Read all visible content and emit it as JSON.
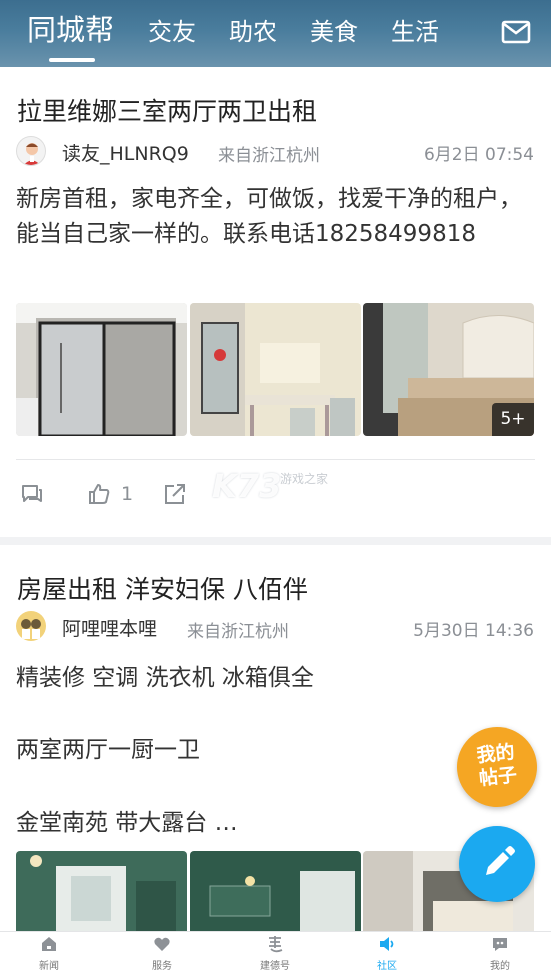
{
  "top_nav": {
    "tabs": [
      {
        "label": "同城帮",
        "active": true
      },
      {
        "label": "交友"
      },
      {
        "label": "助农"
      },
      {
        "label": "美食"
      },
      {
        "label": "生活"
      }
    ],
    "mail_icon": "mail-icon"
  },
  "posts": [
    {
      "title": "拉里维娜三室两厅两卫出租",
      "author": "读友_HLNRQ9",
      "origin": "来自浙江杭州",
      "time": "6月2日 07:54",
      "body": "新房首租，家电齐全，可做饭，找爱干净的租户，能当自己家一样的。联系电话18258499818",
      "more_images": "5+",
      "like_count": "1"
    },
    {
      "title": "房屋出租 洋安妇保 八佰伴",
      "author": "阿哩哩本哩",
      "origin": "来自浙江杭州",
      "time": "5月30日 14:36",
      "body_lines": [
        "精装修 空调 洗衣机 冰箱俱全",
        "两室两厅一厨一卫",
        "金堂南苑 带大露台 …"
      ]
    }
  ],
  "watermark": {
    "text": "K73",
    "sub": "游戏之家"
  },
  "floating": {
    "my_posts_line1": "我的",
    "my_posts_line2": "帖子",
    "compose_icon": "pencil-icon"
  },
  "bottom_nav": [
    {
      "label": "新闻",
      "icon": "home-icon"
    },
    {
      "label": "服务",
      "icon": "heart-icon"
    },
    {
      "label": "建德号",
      "icon": "jiande-icon"
    },
    {
      "label": "社区",
      "icon": "community-icon",
      "active": true
    },
    {
      "label": "我的",
      "icon": "profile-icon"
    }
  ],
  "colors": {
    "accent": "#1ba9f0",
    "fab_orange": "#f5a623",
    "nav_bg": "#4a7d9d"
  }
}
